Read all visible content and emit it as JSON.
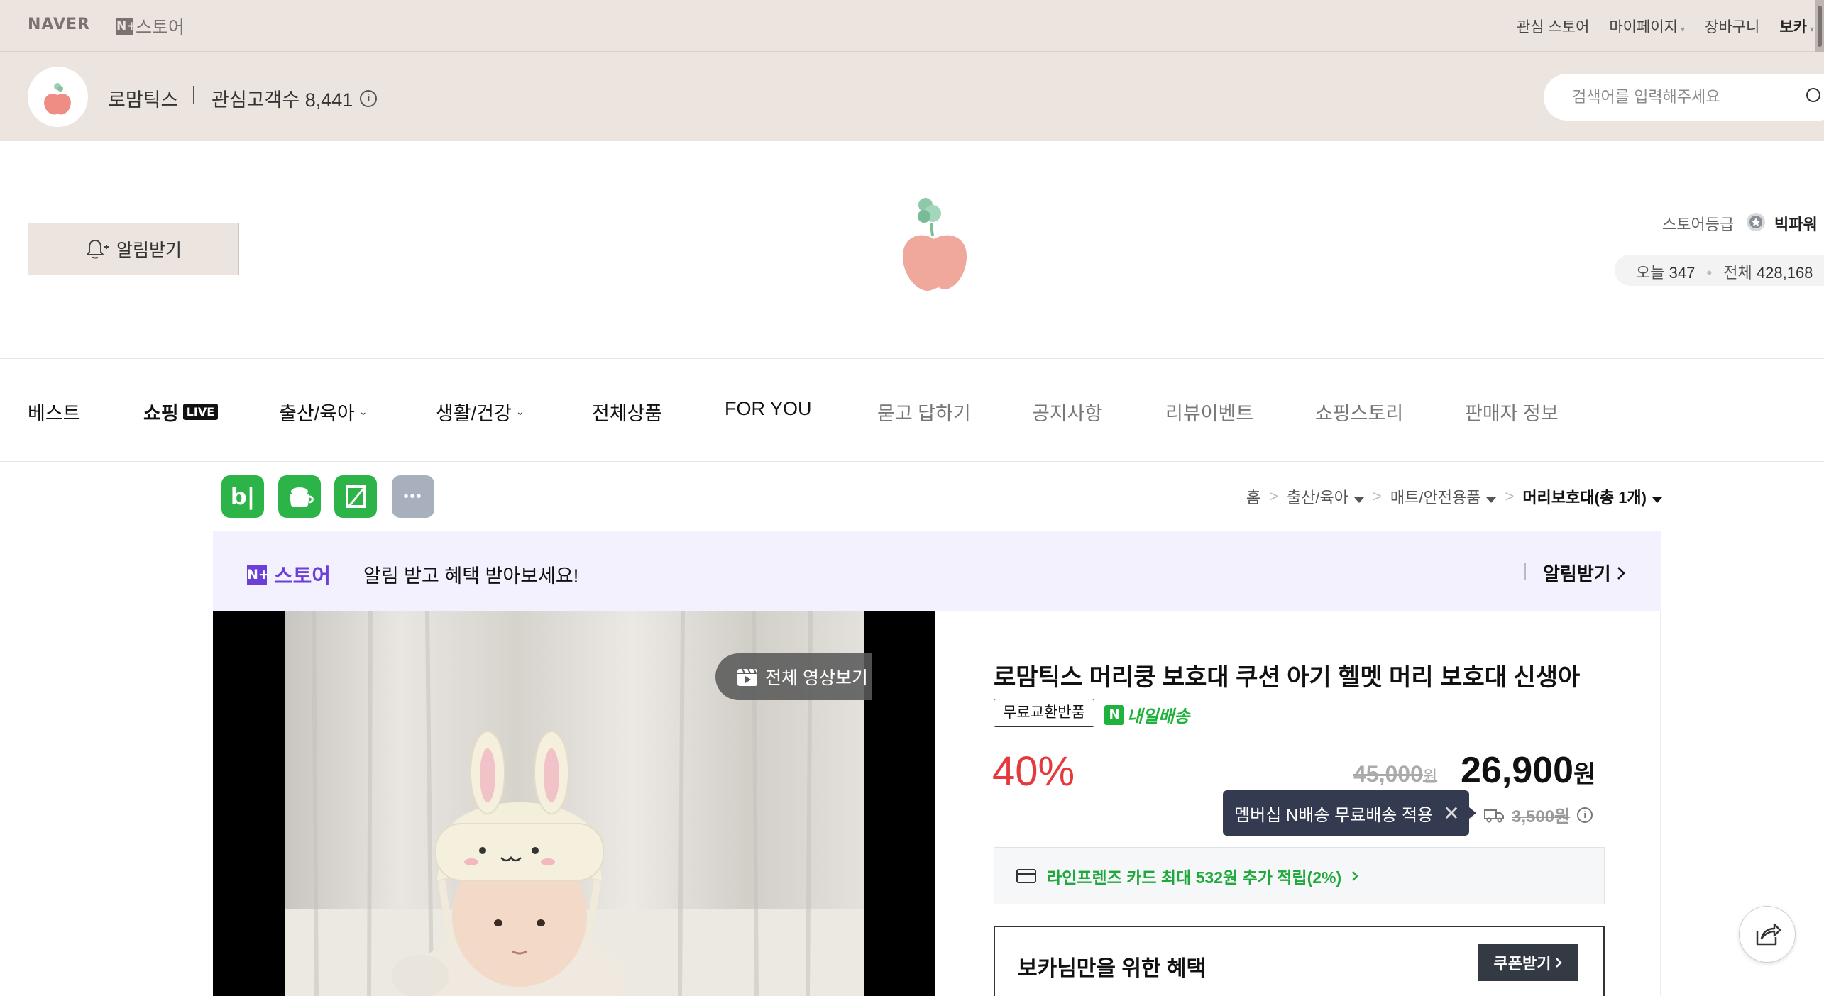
{
  "topbar": {
    "naver_logo": "NAVER",
    "nstore_box": "N+",
    "nstore_text": "스토어",
    "links": {
      "interest_store": "관심 스토어",
      "mypage": "마이페이지",
      "cart": "장바구니",
      "user": "보카"
    }
  },
  "store": {
    "name": "로맘틱스",
    "followers_label": "관심고객수 8,441",
    "search_placeholder": "검색어를 입력해주세요",
    "alarm_button": "알림받기",
    "grade_label": "스토어등급",
    "grade_value": "빅파워",
    "today_label": "오늘",
    "today_count": "347",
    "total_label": "전체",
    "total_count": "428,168"
  },
  "nav": {
    "best": "베스트",
    "shopping": "쇼핑",
    "live_badge": "LIVE",
    "birth": "출산/육아",
    "life": "생활/건강",
    "all": "전체상품",
    "foryou": "FOR YOU",
    "qna": "묻고 답하기",
    "notice": "공지사항",
    "review_event": "리뷰이벤트",
    "story": "쇼핑스토리",
    "seller": "판매자 정보"
  },
  "share": {
    "blog_glyph": "b|",
    "more_glyph": "•••"
  },
  "breadcrumb": {
    "home": "홈",
    "cat1": "출산/육아",
    "cat2": "매트/안전용품",
    "current_prefix": "머리보호대",
    "current_count": "(총 1개)"
  },
  "banner": {
    "logo_box": "N+",
    "logo_text": "스토어",
    "text": "알림 받고 혜택 받아보세요!",
    "cta": "알림받기"
  },
  "media": {
    "video_all": "전체 영상보기"
  },
  "product": {
    "title": "로맘틱스 머리쿵 보호대 쿠션 아기 헬멧 머리 보호대 신생아",
    "tag_return": "무료교환반품",
    "tag_delivery_box": "N",
    "tag_delivery": "내일배송",
    "discount": "40%",
    "original_price": "45,000",
    "original_unit": "원",
    "sale_price": "26,900",
    "sale_unit": "원",
    "tooltip": "멤버십 N배송 무료배송 적용",
    "shipping_fee": "3,500원",
    "card_benefit": "라인프렌즈 카드 최대 532원 추가 적립(2%)",
    "coupon_title": "보카님만을 위한 혜택",
    "coupon_button": "쿠폰받기"
  },
  "colors": {
    "topbar_bg": "#ebe4df",
    "brand_green": "#1fb23d",
    "discount_red": "#e5393d",
    "nplus_purple": "#6b3fd8"
  }
}
